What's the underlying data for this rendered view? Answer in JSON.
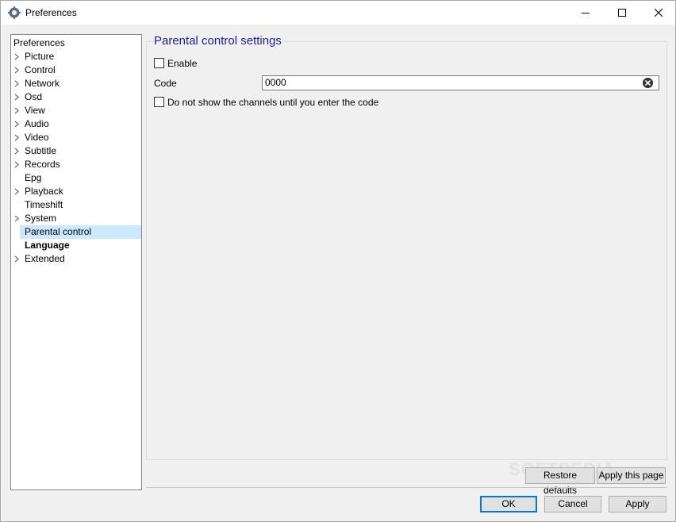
{
  "window": {
    "title": "Preferences"
  },
  "tree": {
    "root": "Preferences",
    "items": [
      {
        "label": "Picture",
        "expandable": true
      },
      {
        "label": "Control",
        "expandable": true
      },
      {
        "label": "Network",
        "expandable": true
      },
      {
        "label": "Osd",
        "expandable": true
      },
      {
        "label": "View",
        "expandable": true
      },
      {
        "label": "Audio",
        "expandable": true
      },
      {
        "label": "Video",
        "expandable": true
      },
      {
        "label": "Subtitle",
        "expandable": true
      },
      {
        "label": "Records",
        "expandable": true
      },
      {
        "label": "Epg",
        "expandable": false
      },
      {
        "label": "Playback",
        "expandable": true
      },
      {
        "label": "Timeshift",
        "expandable": false
      },
      {
        "label": "System",
        "expandable": true
      },
      {
        "label": "Parental control",
        "expandable": false,
        "selected": true
      },
      {
        "label": "Language",
        "expandable": false,
        "bold": true
      },
      {
        "label": "Extended",
        "expandable": true
      }
    ]
  },
  "settings": {
    "title": "Parental control settings",
    "enable_label": "Enable",
    "enable_checked": false,
    "code_label": "Code",
    "code_value": "0000",
    "hide_channels_label": "Do not show the channels until you enter the code",
    "hide_channels_checked": false
  },
  "buttons": {
    "restore_defaults": "Restore defaults",
    "apply_page": "Apply this page",
    "ok": "OK",
    "cancel": "Cancel",
    "apply": "Apply"
  },
  "watermark": "SOFTPEDIA",
  "colors": {
    "accent": "#0078d7",
    "selection": "#cce8ff",
    "group_title": "#1e1e9a"
  }
}
